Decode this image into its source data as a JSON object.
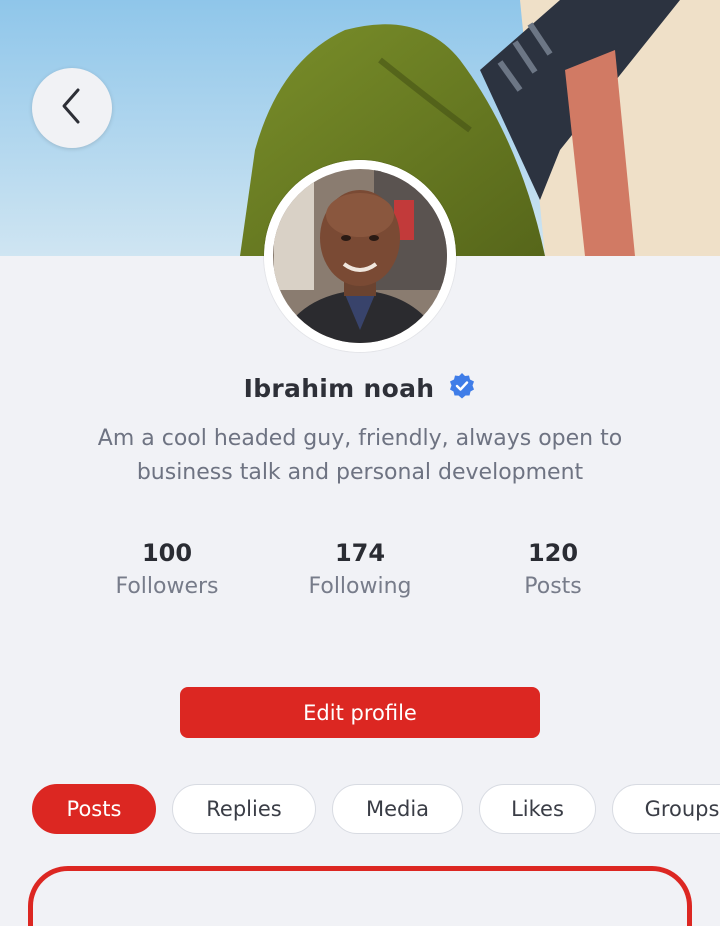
{
  "profile": {
    "name": "Ibrahim noah",
    "bio": "Am a cool headed guy, friendly, always open to business talk and personal development"
  },
  "stats": [
    {
      "value": "100",
      "label": "Followers"
    },
    {
      "value": "174",
      "label": "Following"
    },
    {
      "value": "120",
      "label": "Posts"
    }
  ],
  "actions": {
    "edit_label": "Edit profile"
  },
  "tabs": [
    {
      "label": "Posts",
      "active": true
    },
    {
      "label": "Replies",
      "active": false
    },
    {
      "label": "Media",
      "active": false
    },
    {
      "label": "Likes",
      "active": false
    },
    {
      "label": "Groups",
      "active": false
    }
  ],
  "colors": {
    "accent": "#dc2722",
    "verified": "#3f7de8",
    "background": "#f1f2f6"
  },
  "icons": {
    "back": "chevron-left-icon",
    "verified": "verified-badge-icon"
  }
}
